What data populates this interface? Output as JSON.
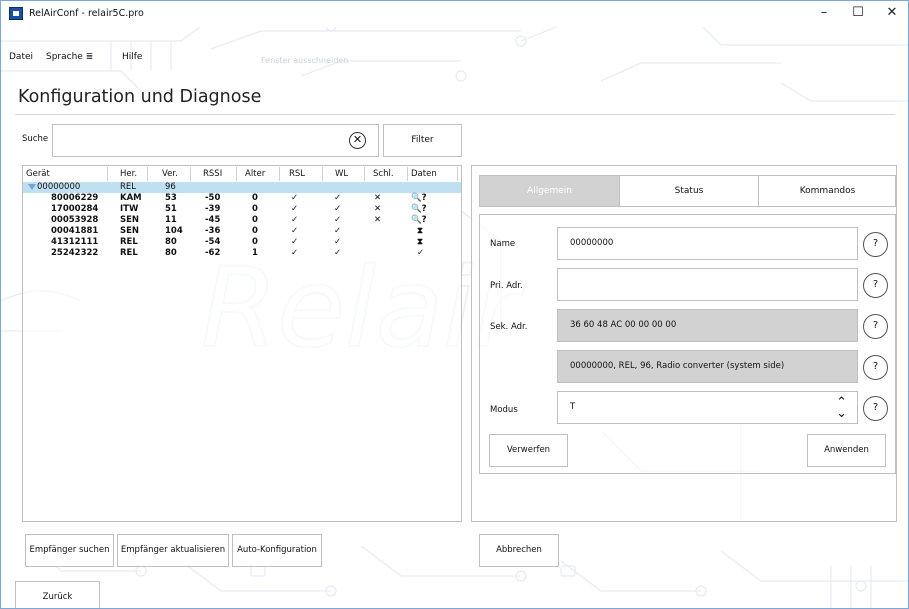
{
  "window": {
    "title": "RelAirConf - relair5C.pro",
    "minimize": "–",
    "maximize": "☐",
    "close": "✕"
  },
  "menu": {
    "file": "Datei",
    "language": "Sprache",
    "language_icon": "≣",
    "help": "Hilfe",
    "greyed": "Fenster ausschneiden"
  },
  "page": {
    "heading": "Konfiguration und Diagnose"
  },
  "search": {
    "label": "Suche",
    "value": "",
    "clear": "✕",
    "filter_label": "Filter"
  },
  "table": {
    "columns": [
      "Gerät",
      "Her.",
      "Ver.",
      "RSSI",
      "Alter",
      "RSL",
      "WL",
      "Schl.",
      "Daten"
    ],
    "rows": [
      {
        "device": "00000000",
        "manufacturer": "REL",
        "version": "96",
        "rssi": "",
        "age": "",
        "rsl": "",
        "wl": "",
        "key": "",
        "data": ""
      },
      {
        "device": "80006229",
        "manufacturer": "KAM",
        "version": "53",
        "rssi": "-50",
        "age": "0",
        "rsl": "✓",
        "wl": "✓",
        "key": "✕",
        "data": "🔍?"
      },
      {
        "device": "17000284",
        "manufacturer": "ITW",
        "version": "51",
        "rssi": "-39",
        "age": "0",
        "rsl": "✓",
        "wl": "✓",
        "key": "✕",
        "data": "🔍?"
      },
      {
        "device": "00053928",
        "manufacturer": "SEN",
        "version": "11",
        "rssi": "-45",
        "age": "0",
        "rsl": "✓",
        "wl": "✓",
        "key": "✕",
        "data": "🔍?"
      },
      {
        "device": "00041881",
        "manufacturer": "SEN",
        "version": "104",
        "rssi": "-36",
        "age": "0",
        "rsl": "✓",
        "wl": "✓",
        "key": "",
        "data": "⧗"
      },
      {
        "device": "41312111",
        "manufacturer": "REL",
        "version": "80",
        "rssi": "-54",
        "age": "0",
        "rsl": "✓",
        "wl": "✓",
        "key": "",
        "data": "⧗"
      },
      {
        "device": "25242322",
        "manufacturer": "REL",
        "version": "80",
        "rssi": "-62",
        "age": "1",
        "rsl": "✓",
        "wl": "✓",
        "key": "",
        "data": "✓"
      }
    ]
  },
  "tabs": {
    "general": "Allgemein",
    "status": "Status",
    "commands": "Kommandos"
  },
  "form": {
    "name_label": "Name",
    "name_value": "00000000",
    "pri_label": "Pri. Adr.",
    "pri_value": "",
    "sec_label": "Sek. Adr.",
    "sec_value": "36 60 48 AC 00 00 00 00",
    "info_value": "00000000, REL, 96, Radio converter (system side)",
    "mode_label": "Modus",
    "mode_value": "T",
    "help": "?",
    "discard": "Verwerfen",
    "apply": "Anwenden"
  },
  "buttons": {
    "search_receiver": "Empfänger suchen",
    "update_receiver": "Empfänger aktualisieren",
    "auto_config": "Auto-Konfiguration",
    "cancel": "Abbrechen",
    "back": "Zurück"
  },
  "colors": {
    "selected_row": "#bfe0f0",
    "tab_active": "#d2d2d2",
    "readonly_field": "#d2d2d2"
  }
}
